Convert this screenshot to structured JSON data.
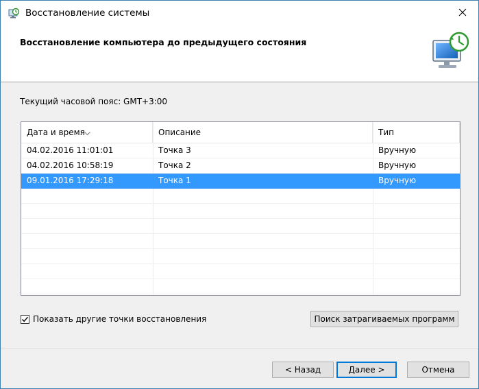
{
  "window": {
    "title": "Восстановление системы",
    "app_icon": "system-restore-icon",
    "close_icon": "close-icon"
  },
  "header": {
    "title": "Восстановление компьютера до предыдущего состояния",
    "art_icon": "restore-monitor-icon"
  },
  "timezone": {
    "label": "Текущий часовой пояс: GMT+3:00"
  },
  "table": {
    "columns": [
      "Дата и время",
      "Описание",
      "Тип"
    ],
    "sort_icon": "sort-caret-icon",
    "rows": [
      {
        "date": "04.02.2016 11:01:01",
        "description": "Точка 3",
        "type": "Вручную",
        "selected": false
      },
      {
        "date": "04.02.2016 10:58:19",
        "description": "Точка 2",
        "type": "Вручную",
        "selected": false
      },
      {
        "date": "09.01.2016 17:29:18",
        "description": "Точка 1",
        "type": "Вручную",
        "selected": true
      }
    ],
    "selection_color": "#3399ff"
  },
  "options": {
    "show_more_label": "Показать другие точки восстановления",
    "show_more_checked": true,
    "scan_button": "Поиск затрагиваемых программ"
  },
  "footer": {
    "back_button": "< Назад",
    "next_button": "Далее >",
    "cancel_button": "Отмена"
  },
  "colors": {
    "accent": "#0078d7",
    "border": "#3c7fb1"
  }
}
